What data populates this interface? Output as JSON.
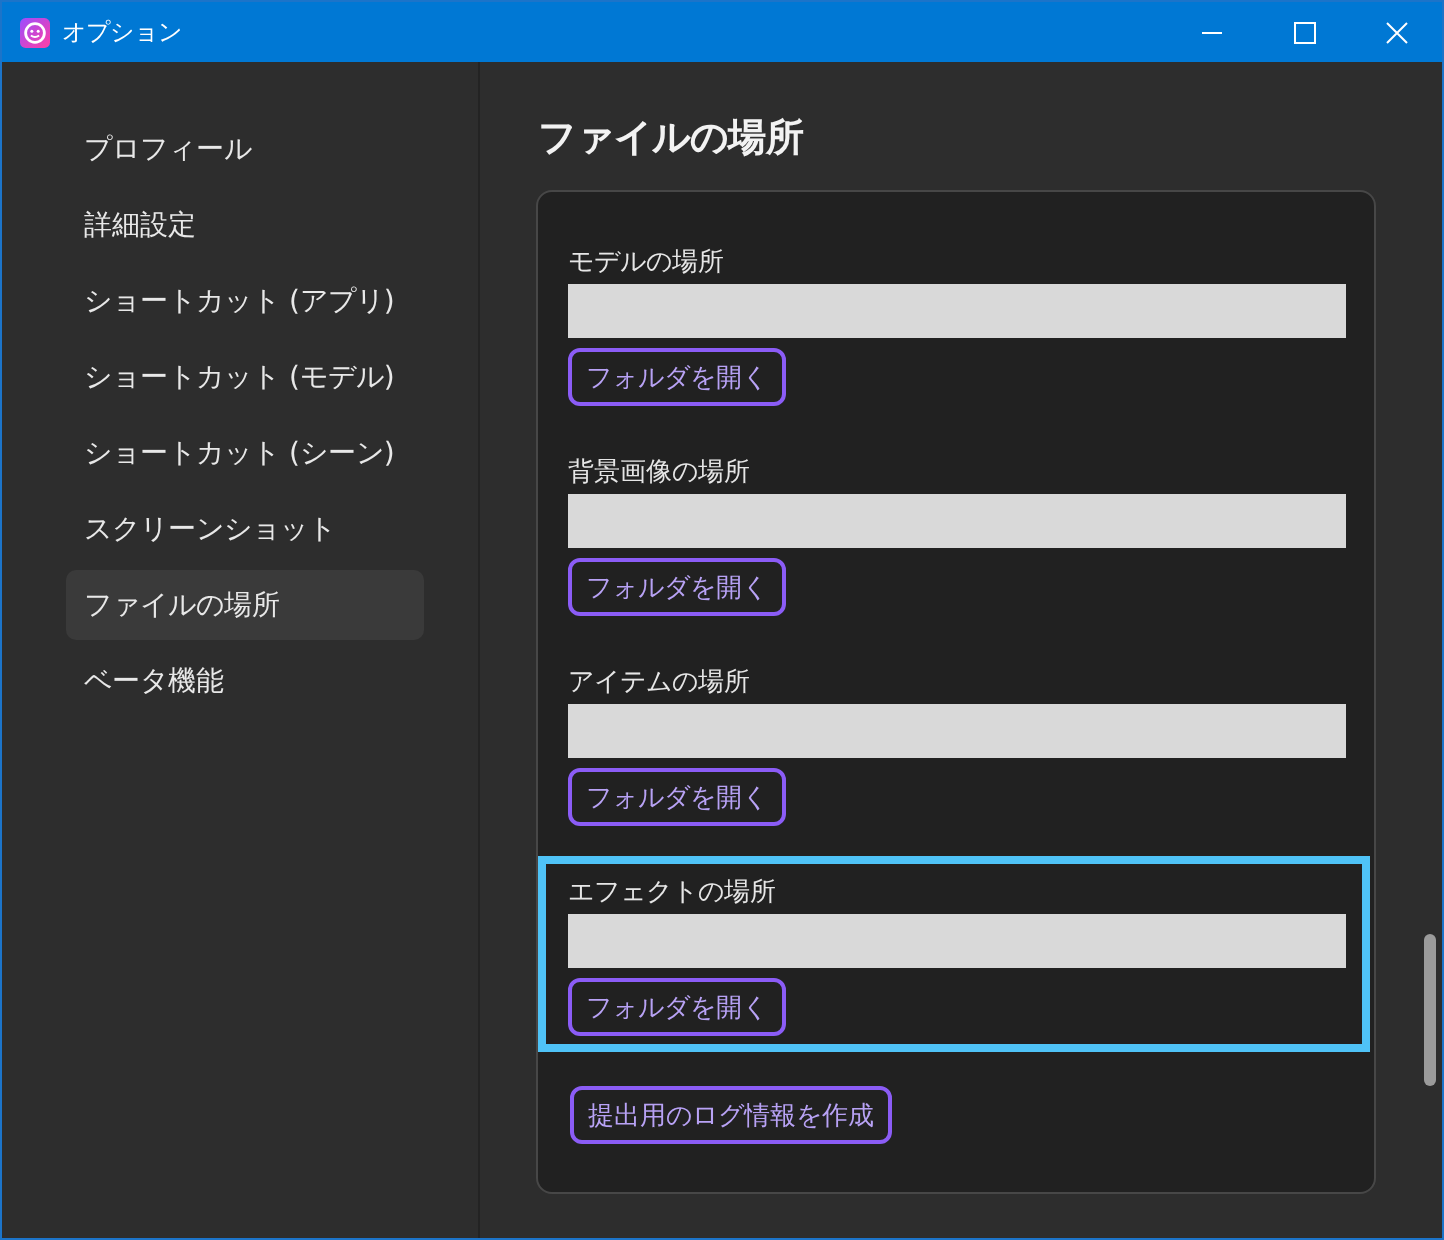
{
  "window": {
    "title": "オプション"
  },
  "sidebar": {
    "items": [
      {
        "label": "プロフィール",
        "selected": false
      },
      {
        "label": "詳細設定",
        "selected": false
      },
      {
        "label": "ショートカット (アプリ)",
        "selected": false
      },
      {
        "label": "ショートカット (モデル)",
        "selected": false
      },
      {
        "label": "ショートカット (シーン)",
        "selected": false
      },
      {
        "label": "スクリーンショット",
        "selected": false
      },
      {
        "label": "ファイルの場所",
        "selected": true
      },
      {
        "label": "ベータ機能",
        "selected": false
      }
    ]
  },
  "content": {
    "heading": "ファイルの場所",
    "locations": [
      {
        "label": "モデルの場所",
        "button": "フォルダを開く",
        "highlighted": false
      },
      {
        "label": "背景画像の場所",
        "button": "フォルダを開く",
        "highlighted": false
      },
      {
        "label": "アイテムの場所",
        "button": "フォルダを開く",
        "highlighted": false
      },
      {
        "label": "エフェクトの場所",
        "button": "フォルダを開く",
        "highlighted": true
      }
    ],
    "log_button": "提出用のログ情報を作成"
  }
}
